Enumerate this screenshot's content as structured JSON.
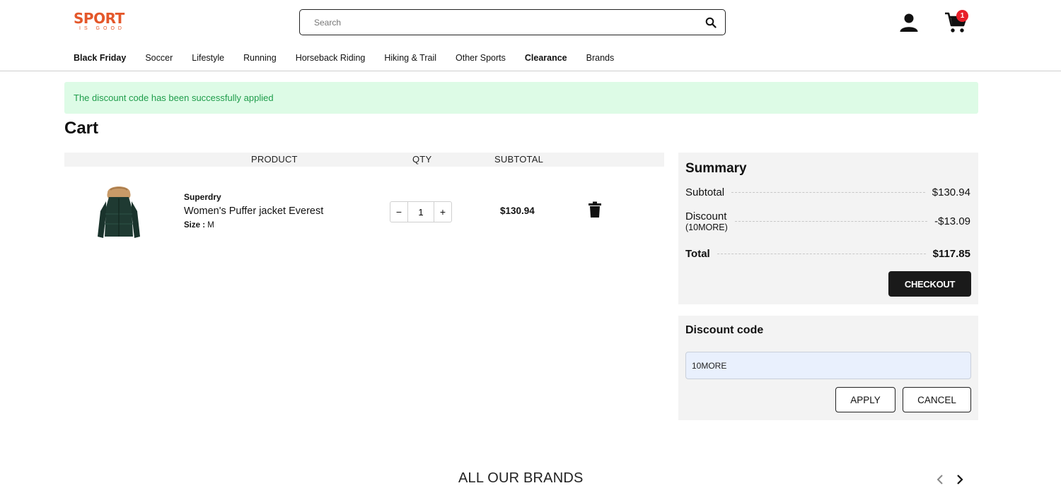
{
  "header": {
    "logo_text": "SPORT",
    "logo_tagline": "IS GOOD",
    "search_placeholder": "Search",
    "cart_count": "1"
  },
  "nav": [
    {
      "label": "Black Friday",
      "bold": true
    },
    {
      "label": "Soccer",
      "bold": false
    },
    {
      "label": "Lifestyle",
      "bold": false
    },
    {
      "label": "Running",
      "bold": false
    },
    {
      "label": "Horseback Riding",
      "bold": false
    },
    {
      "label": "Hiking & Trail",
      "bold": false
    },
    {
      "label": "Other Sports",
      "bold": false
    },
    {
      "label": "Clearance",
      "bold": true
    },
    {
      "label": "Brands",
      "bold": false
    }
  ],
  "alert": {
    "message": "The discount code has been successfully applied"
  },
  "page": {
    "title": "Cart"
  },
  "cart": {
    "columns": {
      "product": "PRODUCT",
      "qty": "QTY",
      "subtotal": "SUBTOTAL"
    },
    "items": [
      {
        "brand": "Superdry",
        "name": "Women's Puffer jacket Everest",
        "size_label": "Size :",
        "size": "M",
        "qty": "1",
        "subtotal": "$130.94",
        "image": "dark green puffer jacket with fur hood"
      }
    ]
  },
  "summary": {
    "title": "Summary",
    "subtotal_label": "Subtotal",
    "subtotal": "$130.94",
    "discount_label": "Discount",
    "discount_code": "(10MORE)",
    "discount": "-$13.09",
    "total_label": "Total",
    "total": "$117.85",
    "checkout_label": "CHECKOUT"
  },
  "discount_panel": {
    "title": "Discount code",
    "value": "10MORE",
    "apply_label": "APPLY",
    "cancel_label": "CANCEL"
  },
  "brands": {
    "title": "ALL OUR BRANDS"
  },
  "colors": {
    "logo": "#e4572a",
    "alert_bg": "#ddfbe6",
    "alert_text": "#1f9d4b",
    "badge": "#e8202a",
    "checkout_bg": "#1a1a1a",
    "panel_bg": "#f3f3f3"
  }
}
